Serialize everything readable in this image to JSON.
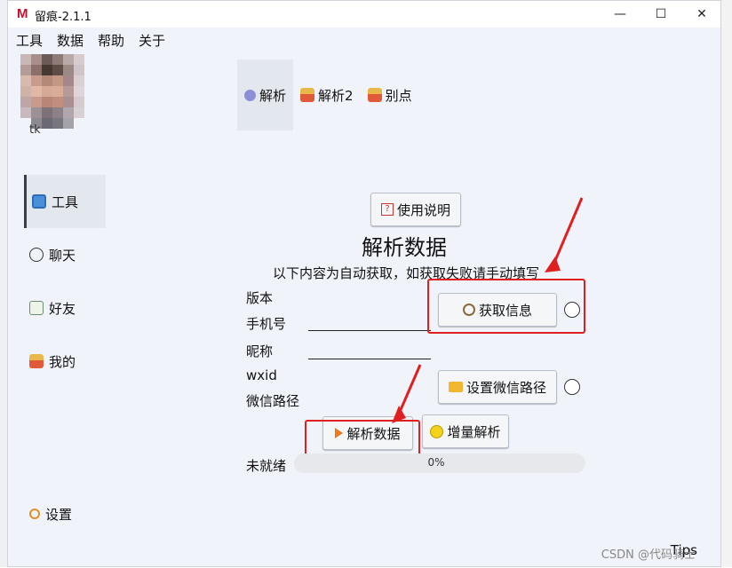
{
  "window": {
    "logo": "M",
    "title": "留痕-2.1.1",
    "minimize": "—",
    "maximize": "☐",
    "close": "✕"
  },
  "menu": [
    "工具",
    "数据",
    "帮助",
    "关于"
  ],
  "sidebar": {
    "avatar_caption": "tk",
    "items": [
      {
        "label": "工具",
        "icon": "tools-icon",
        "active": true
      },
      {
        "label": "聊天",
        "icon": "chat-icon"
      },
      {
        "label": "好友",
        "icon": "contacts-icon"
      },
      {
        "label": "我的",
        "icon": "home-icon"
      }
    ],
    "settings": "设置"
  },
  "tabs": [
    {
      "label": "解析",
      "icon": "gear-circle-icon",
      "active": true
    },
    {
      "label": "解析2",
      "icon": "house-icon"
    },
    {
      "label": "别点",
      "icon": "house-icon"
    }
  ],
  "main": {
    "help_button": "使用说明",
    "heading": "解析数据",
    "hint": "以下内容为自动获取，如获取失败请手动填写",
    "fields": {
      "version": "版本",
      "phone": "手机号",
      "nickname": "昵称",
      "wxid": "wxid",
      "path": "微信路径"
    },
    "get_info_button": "获取信息",
    "set_path_button": "设置微信路径",
    "parse_button": "解析数据",
    "incremental_button": "增量解析",
    "status": "未就绪",
    "progress": "0%",
    "progress_value": 0
  },
  "footer": {
    "tips": "Tips",
    "watermark": "CSDN @代码骑士"
  },
  "colors": {
    "annotation_red": "#e02020",
    "window_bg": "#f0f3fa",
    "active_bg": "#e3e7ee"
  }
}
